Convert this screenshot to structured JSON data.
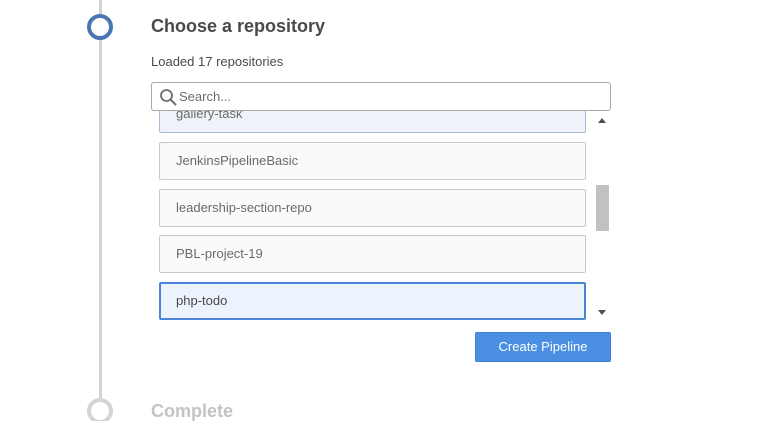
{
  "steps": {
    "current": {
      "title": "Choose a repository",
      "status": "active"
    },
    "next": {
      "title": "Complete",
      "status": "pending"
    }
  },
  "repository": {
    "loaded_text": "Loaded 17 repositories",
    "search": {
      "placeholder": "Search...",
      "value": ""
    },
    "items": [
      {
        "label": "gallery-task",
        "state": "partially-visible"
      },
      {
        "label": "JenkinsPipelineBasic",
        "state": "normal"
      },
      {
        "label": "leadership-section-repo",
        "state": "normal"
      },
      {
        "label": "PBL-project-19",
        "state": "normal"
      },
      {
        "label": "php-todo",
        "state": "selected"
      }
    ],
    "scroll_position": 0.75
  },
  "actions": {
    "create_label": "Create Pipeline"
  },
  "colors": {
    "accent": "#4a8fe2",
    "step_active": "#4a77b4",
    "step_pending": "#d4d4d4",
    "selected_border": "#4a85d6"
  },
  "icons": {
    "search": "search-icon",
    "scroll_up": "scroll-up-arrow-icon",
    "scroll_down": "scroll-down-arrow-icon"
  }
}
